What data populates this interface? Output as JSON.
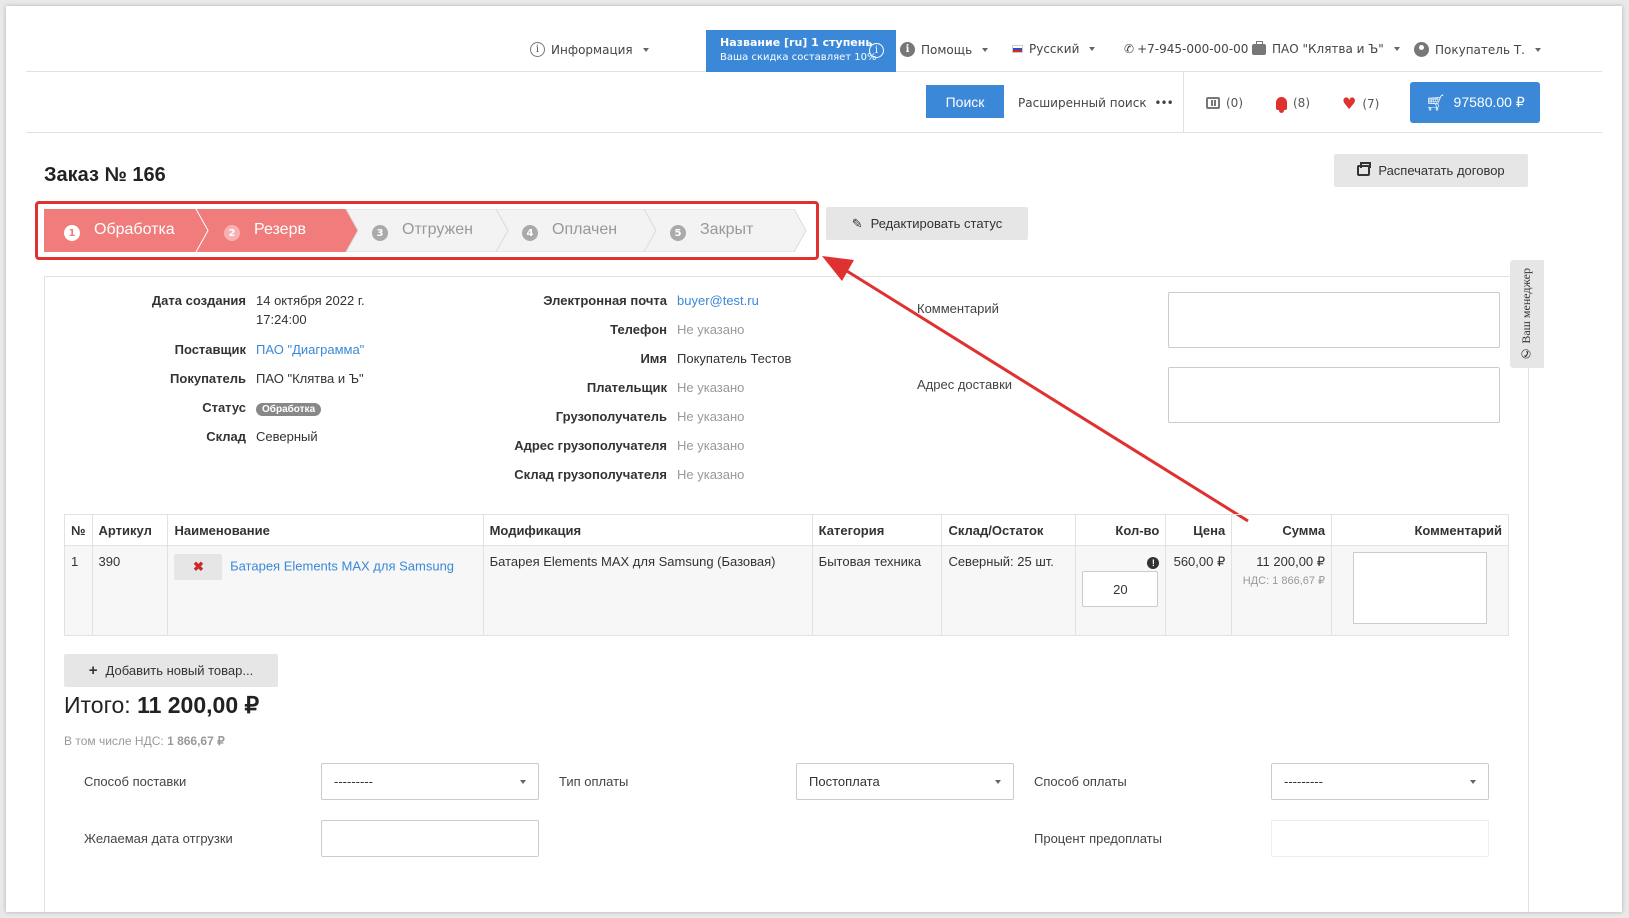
{
  "topbar": {
    "info": "Информация",
    "promo_title": "Название [ru] 1 ступень",
    "promo_sub": "Ваша скидка составляет 10%",
    "help": "Помощь",
    "language": "Русский",
    "phone": "+7-945-000-00-00",
    "company": "ПАО \"Клятва и Ъ\"",
    "user": "Покупатель Т."
  },
  "bar2": {
    "search_button": "Поиск",
    "advanced_search": "Расширенный поиск",
    "compare_count": "(0)",
    "notifications_count": "(8)",
    "favorites_count": "(7)",
    "cart_total": "97580.00 ₽"
  },
  "order": {
    "title": "Заказ № 166",
    "print_button": "Распечатать договор",
    "edit_status_button": "Редактировать статус"
  },
  "steps": [
    {
      "num": "1",
      "label": "Обработка",
      "active": true
    },
    {
      "num": "2",
      "label": "Резерв",
      "active": true
    },
    {
      "num": "3",
      "label": "Отгружен",
      "active": false
    },
    {
      "num": "4",
      "label": "Оплачен",
      "active": false
    },
    {
      "num": "5",
      "label": "Закрыт",
      "active": false
    }
  ],
  "colors": {
    "accent": "#3a88d7",
    "step_active": "#f07c7c",
    "step_inactive": "#f1f1f1",
    "highlight": "#e03131"
  },
  "details_left": {
    "created_label": "Дата создания",
    "created_value_1": "14 октября 2022 г.",
    "created_value_2": "17:24:00",
    "supplier_label": "Поставщик",
    "supplier_value": "ПАО \"Диаграмма\"",
    "buyer_label": "Покупатель",
    "buyer_value": "ПАО \"Клятва и Ъ\"",
    "status_label": "Статус",
    "status_value": "Обработка",
    "warehouse_label": "Склад",
    "warehouse_value": "Северный"
  },
  "details_mid": {
    "email_label": "Электронная почта",
    "email_value": "buyer@test.ru",
    "phone_label": "Телефон",
    "phone_value": "Не указано",
    "name_label": "Имя",
    "name_value": "Покупатель Тестов",
    "payer_label": "Плательщик",
    "payer_value": "Не указано",
    "consignee_label": "Грузополучатель",
    "consignee_value": "Не указано",
    "consignee_addr_label": "Адрес грузополучателя",
    "consignee_addr_value": "Не указано",
    "consignee_wh_label": "Склад грузополучателя",
    "consignee_wh_value": "Не указано"
  },
  "details_right": {
    "comment_label": "Комментарий",
    "delivery_address_label": "Адрес доставки"
  },
  "side_tab": {
    "line1": "Ваш",
    "line2": "менеджер"
  },
  "table": {
    "headers": [
      "№",
      "Артикул",
      "Наименование",
      "Модификация",
      "Категория",
      "Склад/Остаток",
      "Кол-во",
      "Цена",
      "Сумма",
      "Комментарий"
    ],
    "rows": [
      {
        "num": "1",
        "article": "390",
        "name": "Батарея Elements MAX для Samsung",
        "modification": "Батарея Elements MAX для Samsung (Базовая)",
        "category": "Бытовая техника",
        "stock": "Северный: 25 шт.",
        "qty": "20",
        "price": "560,00 ₽",
        "sum": "11 200,00 ₽",
        "sum_vat": "НДС: 1 866,67 ₽"
      }
    ]
  },
  "footer": {
    "add_button": "Добавить новый товар...",
    "total_label": "Итого:",
    "total_value": "11 200,00 ₽",
    "vat_label": "В том числе НДС:",
    "vat_value": "1 866,67 ₽",
    "delivery_method_label": "Способ поставки",
    "delivery_method_value": "---------",
    "payment_type_label": "Тип оплаты",
    "payment_type_value": "Постоплата",
    "payment_method_label": "Способ оплаты",
    "payment_method_value": "---------",
    "ship_date_label": "Желаемая дата отгрузки",
    "prepay_label": "Процент предоплаты"
  }
}
